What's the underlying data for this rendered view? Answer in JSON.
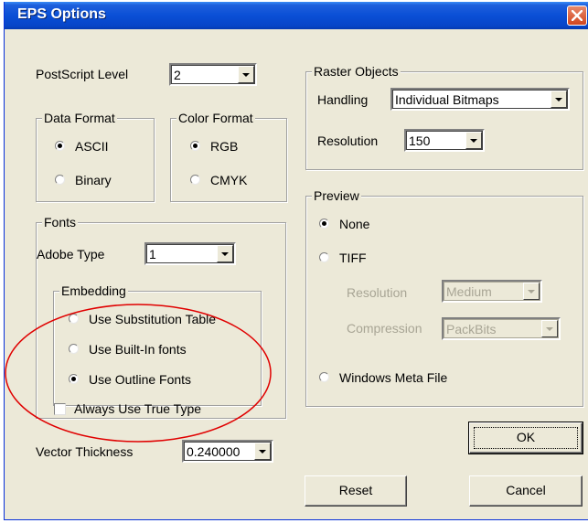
{
  "window": {
    "title": "EPS Options"
  },
  "postscript": {
    "label": "PostScript Level",
    "value": "2"
  },
  "data_format": {
    "legend": "Data Format",
    "options": [
      {
        "label": "ASCII",
        "selected": true
      },
      {
        "label": "Binary",
        "selected": false
      }
    ]
  },
  "color_format": {
    "legend": "Color Format",
    "options": [
      {
        "label": "RGB",
        "selected": true
      },
      {
        "label": "CMYK",
        "selected": false
      }
    ]
  },
  "fonts": {
    "legend": "Fonts",
    "adobe_type_label": "Adobe Type",
    "adobe_type_value": "1",
    "embedding": {
      "legend": "Embedding",
      "options": [
        {
          "label": "Use Substitution Table",
          "selected": false
        },
        {
          "label": "Use Built-In fonts",
          "selected": false
        },
        {
          "label": "Use Outline Fonts",
          "selected": true
        }
      ]
    },
    "always_true_type": {
      "label": "Always Use True Type",
      "checked": false
    }
  },
  "vector_thickness": {
    "label": "Vector Thickness",
    "value": "0.240000"
  },
  "raster": {
    "legend": "Raster Objects",
    "handling_label": "Handling",
    "handling_value": "Individual Bitmaps",
    "resolution_label": "Resolution",
    "resolution_value": "150"
  },
  "preview": {
    "legend": "Preview",
    "options": [
      {
        "label": "None",
        "selected": true
      },
      {
        "label": "TIFF",
        "selected": false
      },
      {
        "label": "Windows Meta File",
        "selected": false
      }
    ],
    "tiff_resolution_label": "Resolution",
    "tiff_resolution_value": "Medium",
    "tiff_compression_label": "Compression",
    "tiff_compression_value": "PackBits"
  },
  "buttons": {
    "ok": "OK",
    "reset": "Reset",
    "cancel": "Cancel"
  },
  "colors": {
    "dialog_bg": "#ece9d8",
    "titlebar": "#0a4fd6",
    "close_button": "#d2461f",
    "annotation": "#e00000",
    "disabled_text": "#a8a595"
  },
  "icons": {
    "close": "close-icon",
    "dropdown": "chevron-down-icon"
  }
}
